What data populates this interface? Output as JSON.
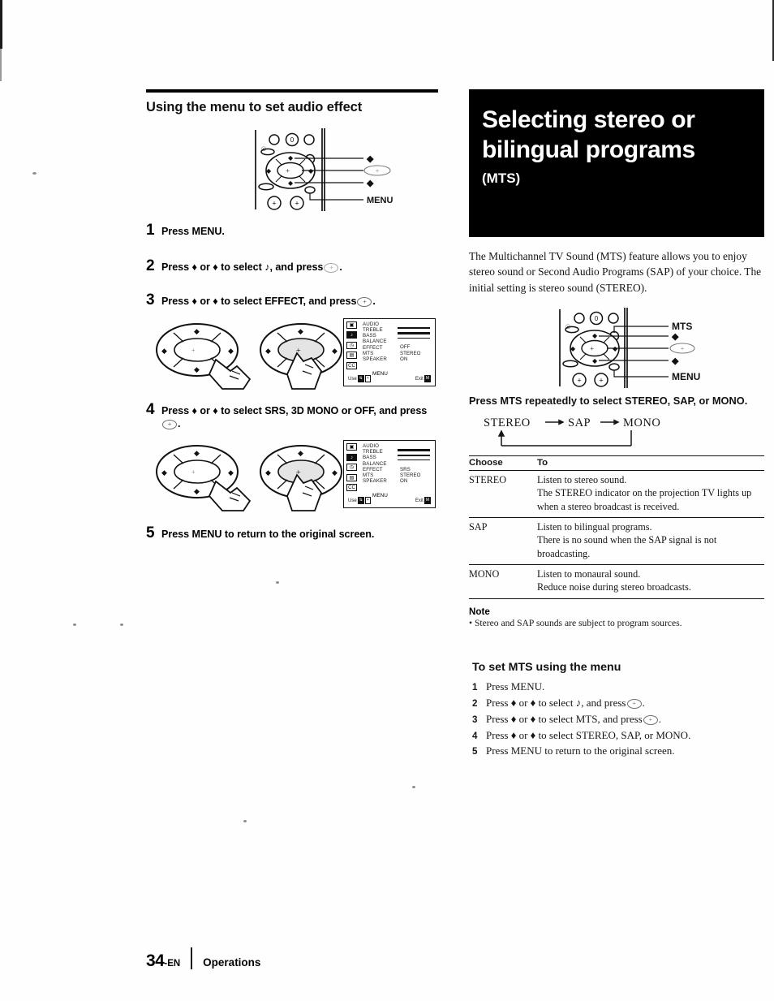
{
  "document": {
    "page_number": "34",
    "page_suffix": "-EN",
    "footer_section": "Operations"
  },
  "left_column": {
    "section_heading": "Using the menu to set audio effect",
    "remote_labels": {
      "up": "♦",
      "enter": "+",
      "down": "♦",
      "menu": "MENU"
    },
    "steps": [
      {
        "num": "1",
        "text_before": "Press MENU.",
        "text_after": ""
      },
      {
        "num": "2",
        "text_before": "Press ♦ or ♦ to select ♪, and press",
        "text_after": "."
      },
      {
        "num": "3",
        "text_before": "Press ♦ or ♦ to select EFFECT, and press",
        "text_after": "."
      },
      {
        "num": "4",
        "text_before": "Press ♦ or ♦ to select SRS, 3D MONO or OFF, and press",
        "text_after": "."
      },
      {
        "num": "5",
        "text_before": "Press MENU to return to the original screen.",
        "text_after": ""
      }
    ],
    "osd_menu_1": {
      "items": [
        "AUDIO",
        "TREBLE",
        "BASS",
        "BALANCE",
        "EFFECT",
        "MTS",
        "SPEAKER"
      ],
      "values": [
        "OFF",
        "STEREO",
        "ON"
      ],
      "use_label": "Use",
      "menu_label": "MENU",
      "exit_label": "Exit",
      "icons": [
        "tv-icon",
        "music-note-icon",
        "clock-icon",
        "setup-icon",
        "cc-icon"
      ]
    },
    "osd_menu_2": {
      "items": [
        "AUDIO",
        "TREBLE",
        "BASS",
        "BALANCE",
        "EFFECT",
        "MTS",
        "SPEAKER"
      ],
      "values": [
        "SRS",
        "STEREO",
        "ON"
      ],
      "use_label": "Use",
      "menu_label": "MENU",
      "exit_label": "Exit",
      "icons": [
        "tv-icon",
        "music-note-icon",
        "clock-icon",
        "setup-icon",
        "cc-icon"
      ]
    }
  },
  "right_column": {
    "title_line1": "Selecting stereo or",
    "title_line2": "bilingual programs",
    "title_sub": "(MTS)",
    "intro": "The Multichannel TV Sound (MTS) feature allows you to enjoy stereo sound or Second Audio Programs (SAP) of your choice. The initial setting is stereo sound (STEREO).",
    "remote_labels": {
      "mts": "MTS",
      "up": "♦",
      "enter": "+",
      "down": "♦",
      "menu": "MENU"
    },
    "instruction": "Press MTS repeatedly to select STEREO, SAP, or MONO.",
    "cycle": [
      "STEREO",
      "SAP",
      "MONO"
    ],
    "table": {
      "headers": [
        "Choose",
        "To"
      ],
      "rows": [
        {
          "choose": "STEREO",
          "to": "Listen to stereo sound.\nThe STEREO indicator on the projection TV lights up when a stereo broadcast is received."
        },
        {
          "choose": "SAP",
          "to": "Listen to bilingual programs.\nThere is no sound when the SAP signal is not broadcasting."
        },
        {
          "choose": "MONO",
          "to": "Listen to monaural sound.\nReduce noise during stereo broadcasts."
        }
      ]
    },
    "note": {
      "heading": "Note",
      "body": "• Stereo and SAP sounds are subject to program sources."
    },
    "menu_section": {
      "heading": "To set MTS using the menu",
      "steps": [
        {
          "num": "1",
          "before": "Press MENU.",
          "after": ""
        },
        {
          "num": "2",
          "before": "Press ♦ or ♦ to select  ♪, and press",
          "after": "."
        },
        {
          "num": "3",
          "before": "Press ♦ or ♦ to select MTS, and press",
          "after": "."
        },
        {
          "num": "4",
          "before": "Press ♦ or ♦ to select STEREO, SAP, or MONO.",
          "after": ""
        },
        {
          "num": "5",
          "before": "Press MENU to return to the original screen.",
          "after": ""
        }
      ]
    }
  }
}
